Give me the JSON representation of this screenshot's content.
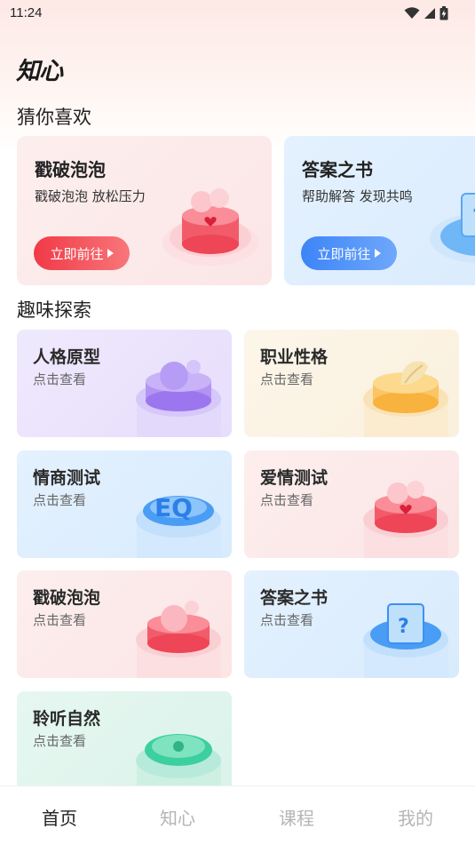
{
  "status_bar": {
    "time": "11:24"
  },
  "app": {
    "logo_text": "知心"
  },
  "sections": {
    "recommend": "猜你喜欢",
    "explore": "趣味探索"
  },
  "recommend_cards": [
    {
      "title": "戳破泡泡",
      "subtitle": "戳破泡泡 放松压力",
      "button": "立即前往"
    },
    {
      "title": "答案之书",
      "subtitle": "帮助解答 发现共鸣",
      "button": "立即前往"
    }
  ],
  "explore_cards": [
    {
      "title": "人格原型",
      "sub": "点击查看"
    },
    {
      "title": "职业性格",
      "sub": "点击查看"
    },
    {
      "title": "情商测试",
      "sub": "点击查看"
    },
    {
      "title": "爱情测试",
      "sub": "点击查看"
    },
    {
      "title": "戳破泡泡",
      "sub": "点击查看"
    },
    {
      "title": "答案之书",
      "sub": "点击查看"
    },
    {
      "title": "聆听自然",
      "sub": "点击查看"
    }
  ],
  "tabs": [
    {
      "label": "首页"
    },
    {
      "label": "知心"
    },
    {
      "label": "课程"
    },
    {
      "label": "我的"
    }
  ]
}
